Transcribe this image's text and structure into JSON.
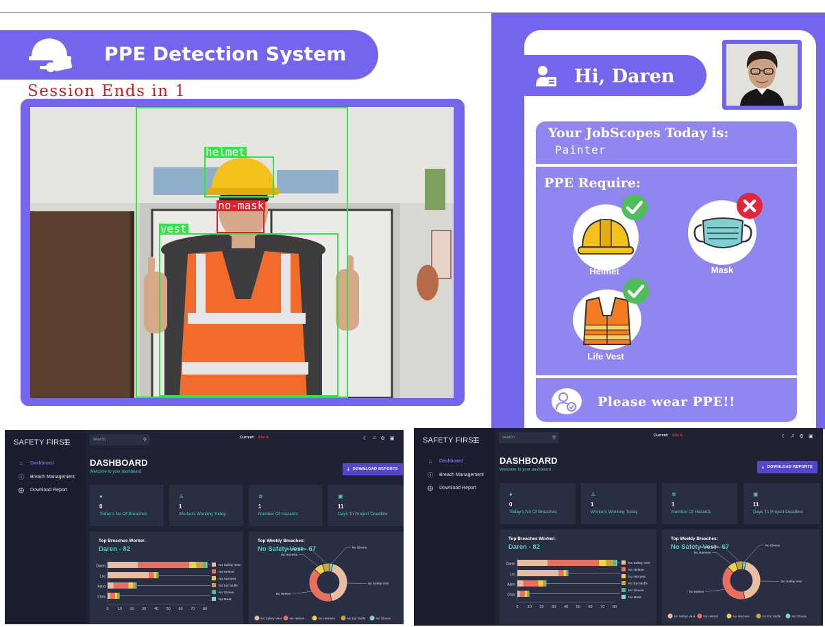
{
  "detection": {
    "title": "PPE Detection System",
    "session_text": "Session Ends in 1",
    "labels": [
      "helmet",
      "no-mask",
      "vest"
    ],
    "colors": {
      "accent": "#7466ec",
      "detected": "#34e24a",
      "missing": "#e0202a"
    }
  },
  "worker_card": {
    "greeting": "Hi, Daren",
    "jobscope_title": "Your JobScopes Today is:",
    "jobscope_value": "Painter",
    "ppe_title": "PPE Require:",
    "items": [
      {
        "name": "Helmet",
        "status": "check",
        "icon": "helmet-icon"
      },
      {
        "name": "Mask",
        "status": "cross",
        "icon": "mask-icon"
      },
      {
        "name": "Life Vest",
        "status": "check",
        "icon": "vest-icon"
      }
    ],
    "footer": "Please wear PPE!!"
  },
  "dashboards": [
    {
      "brand": "SAFETY FIRST",
      "nav": [
        "Dashboard",
        "Breach Management",
        "Download Report"
      ],
      "search_placeholder": "search",
      "current_label": "Current:",
      "current_site": "Site A",
      "title": "DASHBOARD",
      "welcome": "Welcome to your dashboard",
      "download_label": "DOWNLOAD REPORTS",
      "stats": [
        {
          "value": "0",
          "label": "Today's No Of Breaches",
          "icon": "alert-icon"
        },
        {
          "value": "1",
          "label": "Workers Working Today",
          "icon": "workers-icon"
        },
        {
          "value": "1",
          "label": "Number Of Hazards",
          "icon": "hazard-icon"
        },
        {
          "value": "11",
          "label": "Days To Project Deadline",
          "icon": "calendar-icon"
        }
      ],
      "top_worker_title": "Top Breaches Worker:",
      "top_worker_value": "Daren - 82",
      "weekly_title": "Top Weekly Breaches:",
      "weekly_value": "No Safety Vest - 67"
    },
    {
      "brand": "SAFETY FIRST",
      "nav": [
        "Dashboard",
        "Breach Management",
        "Download Report"
      ],
      "search_placeholder": "search",
      "current_label": "Current:",
      "current_site": "Site A",
      "title": "DASHBOARD",
      "welcome": "Welcome to your dashboard",
      "download_label": "DOWNLOAD REPORTS",
      "stats": [
        {
          "value": "0",
          "label": "Today's No Of Breaches",
          "icon": "alert-icon"
        },
        {
          "value": "1",
          "label": "Workers Working Today",
          "icon": "workers-icon"
        },
        {
          "value": "1",
          "label": "Number Of Hazards",
          "icon": "hazard-icon"
        },
        {
          "value": "11",
          "label": "Days To Project Deadline",
          "icon": "calendar-icon"
        }
      ],
      "top_worker_title": "Top Breaches Worker:",
      "top_worker_value": "Daren - 82",
      "weekly_title": "Top Weekly Breaches:",
      "weekly_value": "No Safety Vest - 67"
    }
  ],
  "chart_data": [
    {
      "type": "bar",
      "orientation": "horizontal",
      "stacked": true,
      "categories": [
        "Daren",
        "Loc",
        "Astro",
        "Chris"
      ],
      "series": [
        {
          "name": "No Safety Vest",
          "color": "#e8bea0",
          "values": [
            25,
            34,
            5,
            2
          ]
        },
        {
          "name": "No Helmet",
          "color": "#e8705f",
          "values": [
            42,
            4,
            12,
            4
          ]
        },
        {
          "name": "No Harness",
          "color": "#f0d24a",
          "values": [
            6,
            2,
            4,
            2
          ]
        },
        {
          "name": "No Ear Muffs",
          "color": "#c8a43a",
          "values": [
            6,
            1,
            2,
            1
          ]
        },
        {
          "name": "No Gloves",
          "color": "#4db6ac",
          "values": [
            2,
            1,
            1,
            1
          ]
        },
        {
          "name": "No Mask",
          "color": "#7fd6cf",
          "values": [
            1,
            0,
            0,
            0
          ]
        }
      ],
      "xlim": [
        0,
        80
      ],
      "xticks": [
        "0",
        "10",
        "20",
        "30",
        "40",
        "50",
        "60",
        "70",
        "80"
      ],
      "legend": "right"
    },
    {
      "type": "pie",
      "donut": true,
      "labels": [
        "No Safety Vest",
        "No Helmet",
        "No Harness",
        "No Ear Muffs",
        "No Gloves"
      ],
      "values": [
        67,
        62,
        12,
        10,
        4
      ],
      "colors": [
        "#e8bea0",
        "#e8705f",
        "#f0d24a",
        "#c8a43a",
        "#7fd6cf"
      ],
      "legend": "bottom"
    }
  ]
}
